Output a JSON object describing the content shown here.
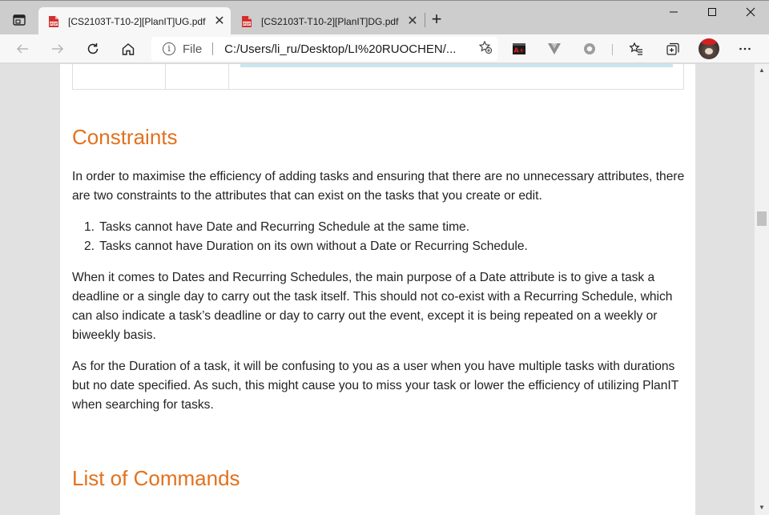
{
  "tabs": [
    {
      "title": "[CS2103T-T10-2][PlanIT]UG.pdf",
      "active": true
    },
    {
      "title": "[CS2103T-T10-2][PlanIT]DG.pdf",
      "active": false
    }
  ],
  "window_controls": {
    "minimize": "—",
    "maximize": "☐",
    "close": "✕"
  },
  "address_bar": {
    "scheme": "File",
    "url": "C:/Users/li_ru/Desktop/LI%20RUOCHEN/..."
  },
  "document": {
    "constraints_heading": "Constraints",
    "constraints_intro": "In order to maximise the efficiency of adding tasks and ensuring that there are no unnecessary attributes, there are two constraints to the attributes that can exist on the tasks that you create or edit.",
    "constraints_list": [
      {
        "num": "1.",
        "text": "Tasks cannot have Date and Recurring Schedule at the same time."
      },
      {
        "num": "2.",
        "text": "Tasks cannot have Duration on its own without a Date or Recurring Schedule."
      }
    ],
    "dates_paragraph": "When it comes to Dates and Recurring Schedules, the main purpose of a Date attribute is to give a task a deadline or a single day to carry out the task itself. This should not co-exist with a Recurring Schedule, which can also indicate a task’s deadline or day to carry out the event, except it is being repeated on a weekly or biweekly basis.",
    "duration_paragraph": "As for the Duration of a task, it will be confusing to you as a user when you have multiple tasks with durations but no date specified. As such, this might cause you to miss your task or lower the efficiency of utilizing PlanIT when searching for tasks.",
    "commands_heading": "List of Commands"
  },
  "colors": {
    "heading": "#e2711d",
    "callout_border": "#c9e6ee",
    "pdf_icon": "#d0312d"
  }
}
